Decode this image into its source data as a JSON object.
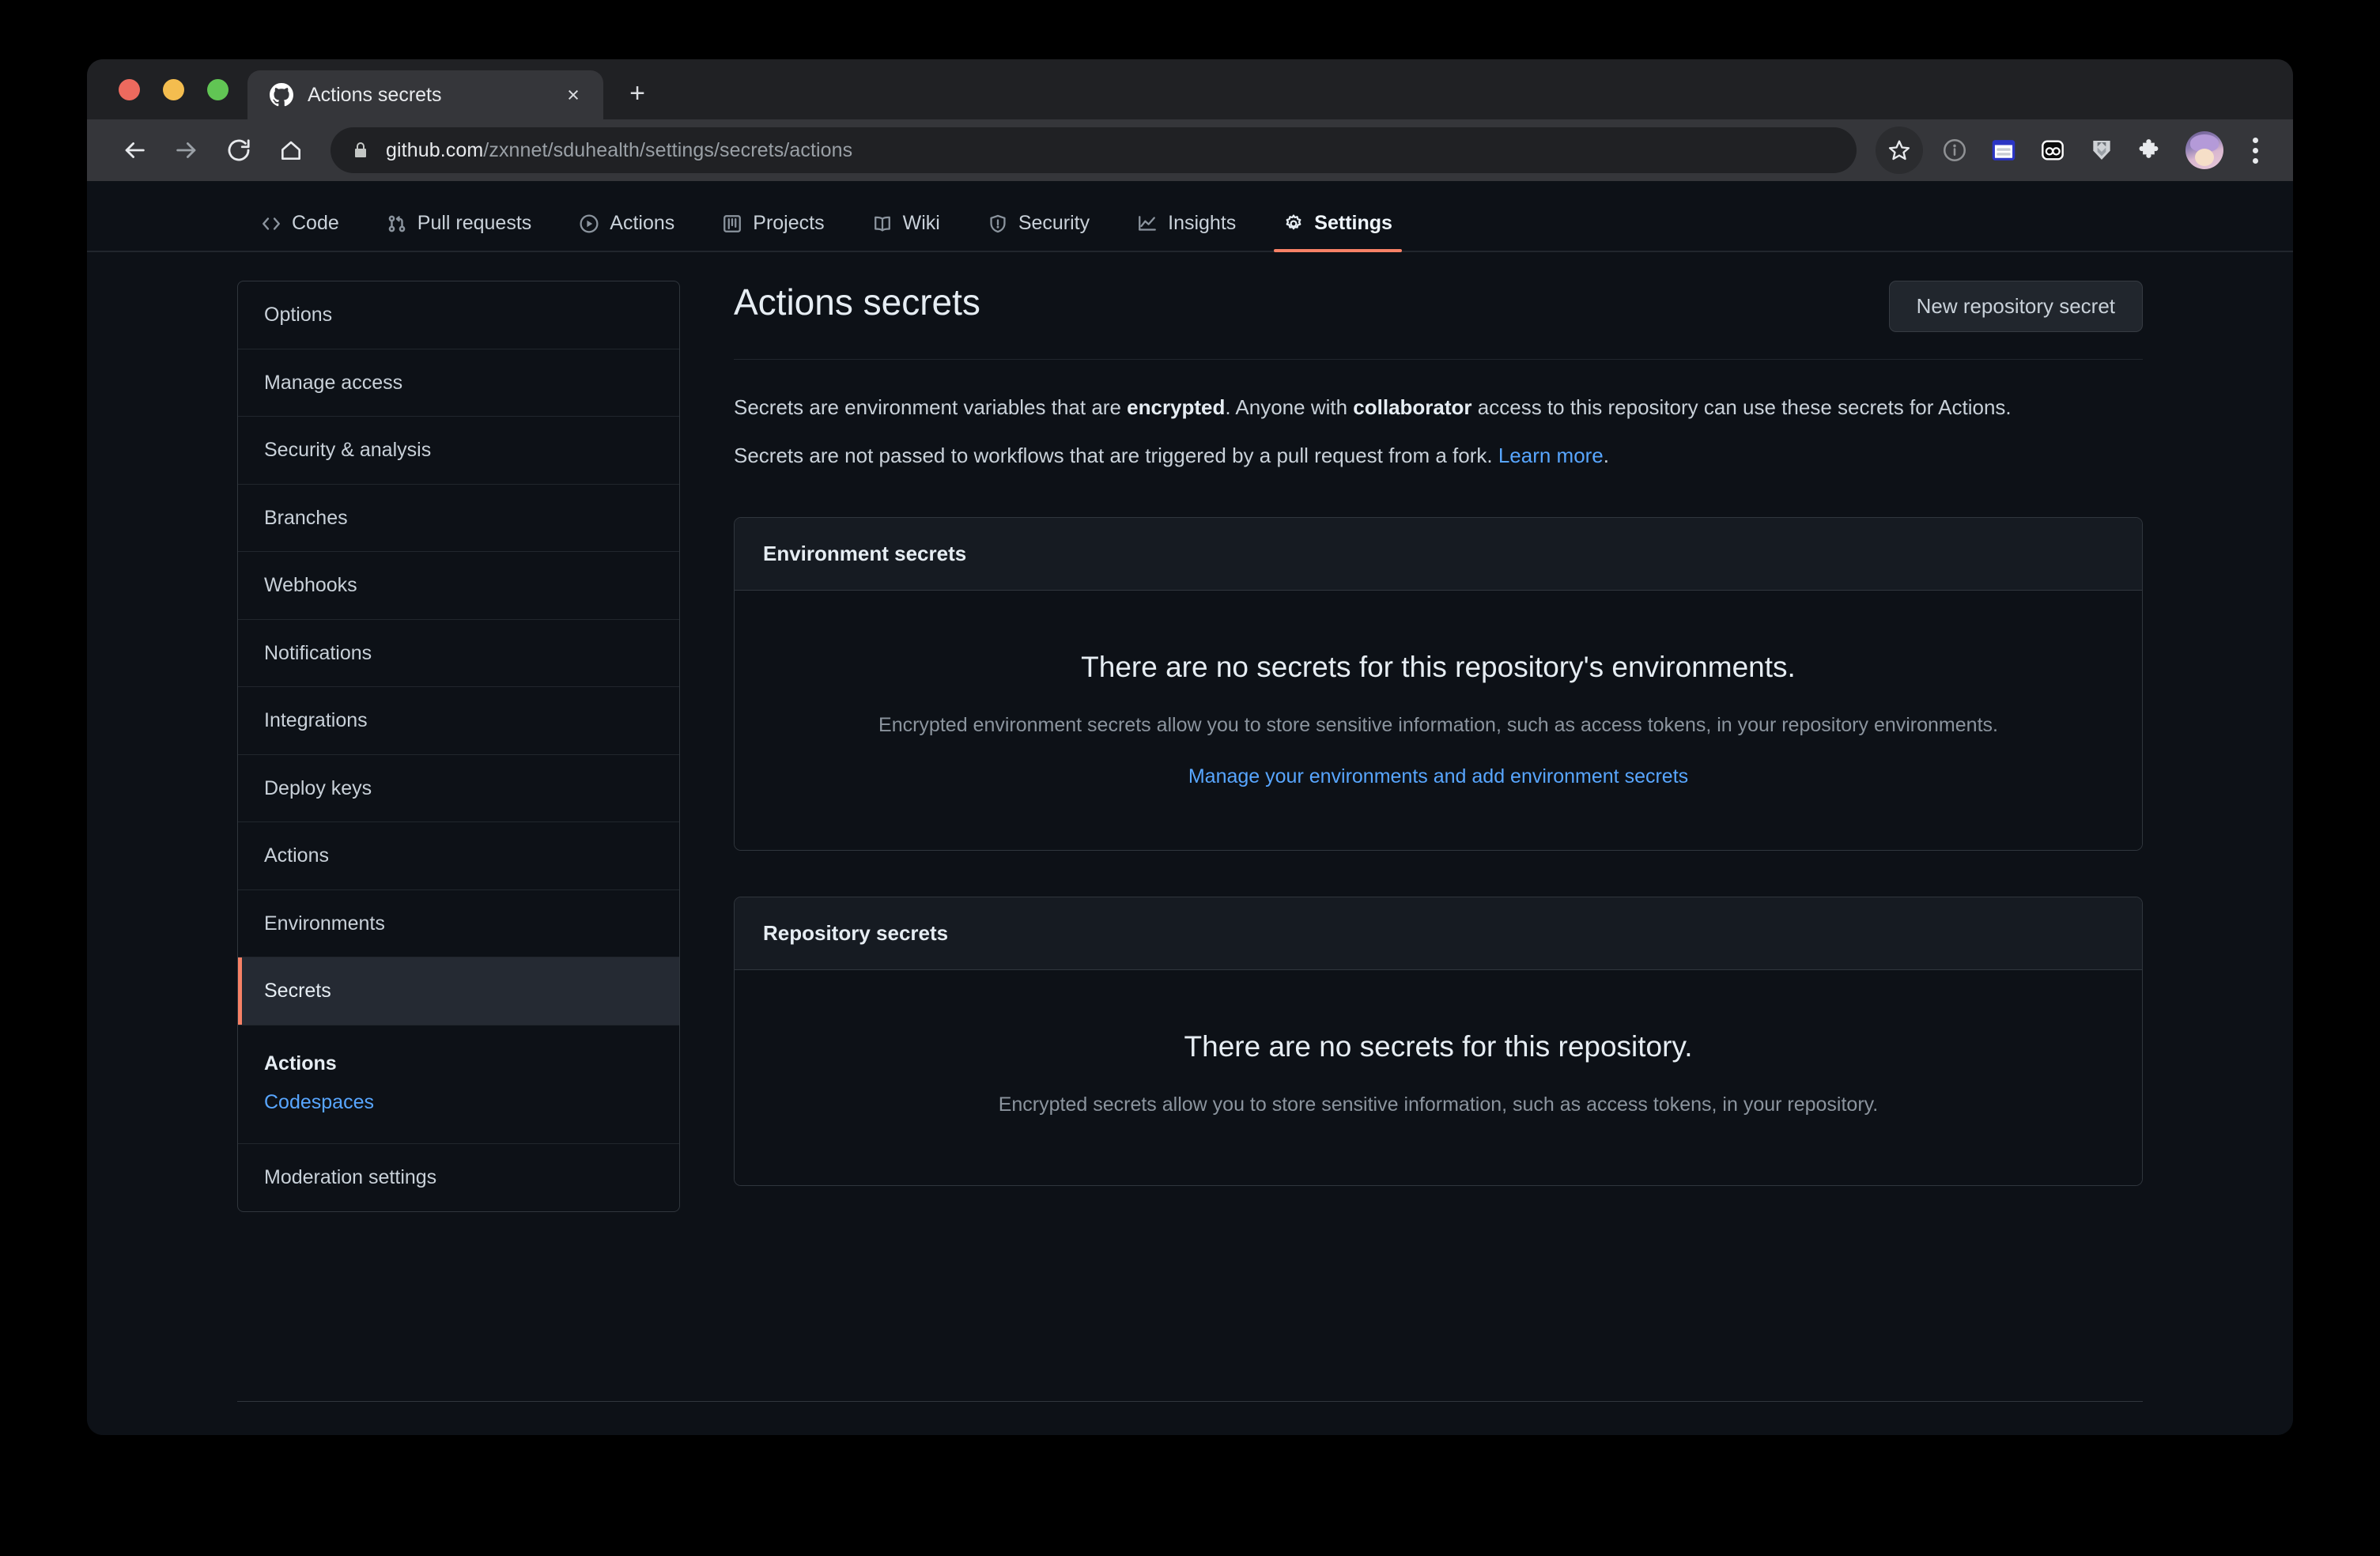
{
  "browser": {
    "tab": {
      "title": "Actions secrets",
      "favicon": "github-icon",
      "close_label": "×"
    },
    "new_tab_label": "+",
    "nav": {
      "back": "back-arrow-icon",
      "forward": "forward-arrow-icon",
      "reload": "reload-icon",
      "home": "home-icon"
    },
    "omnibox": {
      "lock": "lock-icon",
      "url_domain": "github.com",
      "url_path": "/zxnnet/sduhealth/settings/secrets/actions"
    },
    "toolbar_icons": [
      "star-icon",
      "info-circle-icon",
      "reading-list-extension-icon",
      "oo-extension-icon",
      "shield-extension-icon",
      "puzzle-piece-icon"
    ],
    "avatar": "profile-avatar",
    "menu": "three-dot-menu-icon"
  },
  "repo_nav": {
    "items": [
      {
        "label": "Code",
        "icon": "code-icon",
        "active": false
      },
      {
        "label": "Pull requests",
        "icon": "git-pull-request-icon",
        "active": false
      },
      {
        "label": "Actions",
        "icon": "play-circle-icon",
        "active": false
      },
      {
        "label": "Projects",
        "icon": "project-board-icon",
        "active": false
      },
      {
        "label": "Wiki",
        "icon": "book-icon",
        "active": false
      },
      {
        "label": "Security",
        "icon": "shield-alert-icon",
        "active": false
      },
      {
        "label": "Insights",
        "icon": "graph-icon",
        "active": false
      },
      {
        "label": "Settings",
        "icon": "gear-icon",
        "active": true
      }
    ],
    "active_color": "#f78166"
  },
  "sidebar": {
    "items": [
      {
        "label": "Options",
        "active": false
      },
      {
        "label": "Manage access",
        "active": false
      },
      {
        "label": "Security & analysis",
        "active": false
      },
      {
        "label": "Branches",
        "active": false
      },
      {
        "label": "Webhooks",
        "active": false
      },
      {
        "label": "Notifications",
        "active": false
      },
      {
        "label": "Integrations",
        "active": false
      },
      {
        "label": "Deploy keys",
        "active": false
      },
      {
        "label": "Actions",
        "active": false
      },
      {
        "label": "Environments",
        "active": false
      },
      {
        "label": "Secrets",
        "active": true
      }
    ],
    "secrets_subitems": [
      {
        "label": "Actions",
        "selected": true
      },
      {
        "label": "Codespaces",
        "selected": false
      }
    ],
    "moderation": {
      "label": "Moderation settings"
    }
  },
  "main": {
    "title": "Actions secrets",
    "new_secret_button": "New repository secret",
    "intro": {
      "line1_a": "Secrets are environment variables that are ",
      "line1_b": "encrypted",
      "line1_c": ". Anyone with ",
      "line1_d": "collaborator",
      "line1_e": " access to this repository can use these secrets for Actions.",
      "line2_a": "Secrets are not passed to workflows that are triggered by a pull request from a fork. ",
      "line2_link": "Learn more",
      "line2_b": "."
    },
    "environment_panel": {
      "header": "Environment secrets",
      "empty_title": "There are no secrets for this repository's environments.",
      "empty_desc": "Encrypted environment secrets allow you to store sensitive information, such as access tokens, in your repository environments.",
      "link": "Manage your environments and add environment secrets"
    },
    "repository_panel": {
      "header": "Repository secrets",
      "empty_title": "There are no secrets for this repository.",
      "empty_desc": "Encrypted secrets allow you to store sensitive information, such as access tokens, in your repository."
    }
  },
  "colors": {
    "page_bg": "#0d1117",
    "panel_header_bg": "#161b22",
    "border": "#30363d",
    "accent": "#f78166",
    "link": "#58a6ff",
    "text": "#c9d1d9",
    "muted": "#8b949e"
  }
}
